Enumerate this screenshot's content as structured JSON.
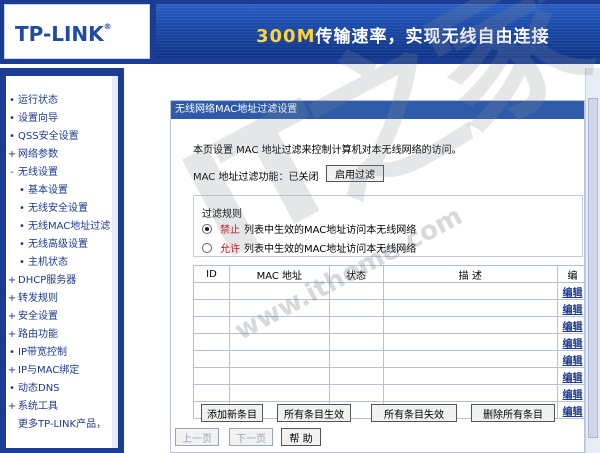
{
  "header": {
    "logo_text": "TP-LINK",
    "logo_mark": "®",
    "banner_number": "300M",
    "banner_slogan": "传输速率，实现无线自由连接"
  },
  "sidebar": {
    "items": [
      {
        "label": "运行状态",
        "bullet": "•",
        "sub": false
      },
      {
        "label": "设置向导",
        "bullet": "•",
        "sub": false
      },
      {
        "label": "QSS安全设置",
        "bullet": "•",
        "sub": false
      },
      {
        "label": "网络参数",
        "bullet": "+",
        "sub": false
      },
      {
        "label": "无线设置",
        "bullet": "-",
        "sub": false
      },
      {
        "label": "基本设置",
        "bullet": "•",
        "sub": true
      },
      {
        "label": "无线安全设置",
        "bullet": "•",
        "sub": true
      },
      {
        "label": "无线MAC地址过滤",
        "bullet": "•",
        "sub": true
      },
      {
        "label": "无线高级设置",
        "bullet": "•",
        "sub": true
      },
      {
        "label": "主机状态",
        "bullet": "•",
        "sub": true
      },
      {
        "label": "DHCP服务器",
        "bullet": "+",
        "sub": false
      },
      {
        "label": "转发规则",
        "bullet": "+",
        "sub": false
      },
      {
        "label": "安全设置",
        "bullet": "+",
        "sub": false
      },
      {
        "label": "路由功能",
        "bullet": "+",
        "sub": false
      },
      {
        "label": "IP带宽控制",
        "bullet": "•",
        "sub": false
      },
      {
        "label": "IP与MAC绑定",
        "bullet": "+",
        "sub": false
      },
      {
        "label": "动态DNS",
        "bullet": "•",
        "sub": false
      },
      {
        "label": "系统工具",
        "bullet": "+",
        "sub": false
      },
      {
        "label": "更多TP-LINK产品，",
        "bullet": "",
        "sub": false
      }
    ]
  },
  "panel": {
    "title": "无线网络MAC地址过滤设置",
    "description": "本页设置 MAC 地址过滤来控制计算机对本无线网络的访问。",
    "status_label": "MAC 地址过滤功能：已关闭",
    "enable_button": "启用过滤",
    "rules_title": "过滤规则",
    "rule_deny_keyword": "禁止",
    "rule_deny_text": "列表中生效的MAC地址访问本无线网络",
    "rule_allow_keyword": "允许",
    "rule_allow_text": "列表中生效的MAC地址访问本无线网络"
  },
  "table": {
    "headers": [
      "ID",
      "MAC 地址",
      "状态",
      "描 述",
      "编"
    ],
    "edit_label": "编辑",
    "row_count": 8
  },
  "actions": {
    "add": "添加新条目",
    "enable_all": "所有条目生效",
    "disable_all": "所有条目失效",
    "delete_all": "删除所有条目"
  },
  "pager": {
    "prev": "上一页",
    "next": "下一页",
    "help": "帮 助"
  },
  "watermark": {
    "letters": "IT之家",
    "url": "www.ithome.com"
  },
  "colors": {
    "frame_blue": "#1a3d93",
    "title_bar": "#2e5aa8",
    "keyword_red": "#cc0000",
    "banner_yellow": "#ffd23a"
  }
}
